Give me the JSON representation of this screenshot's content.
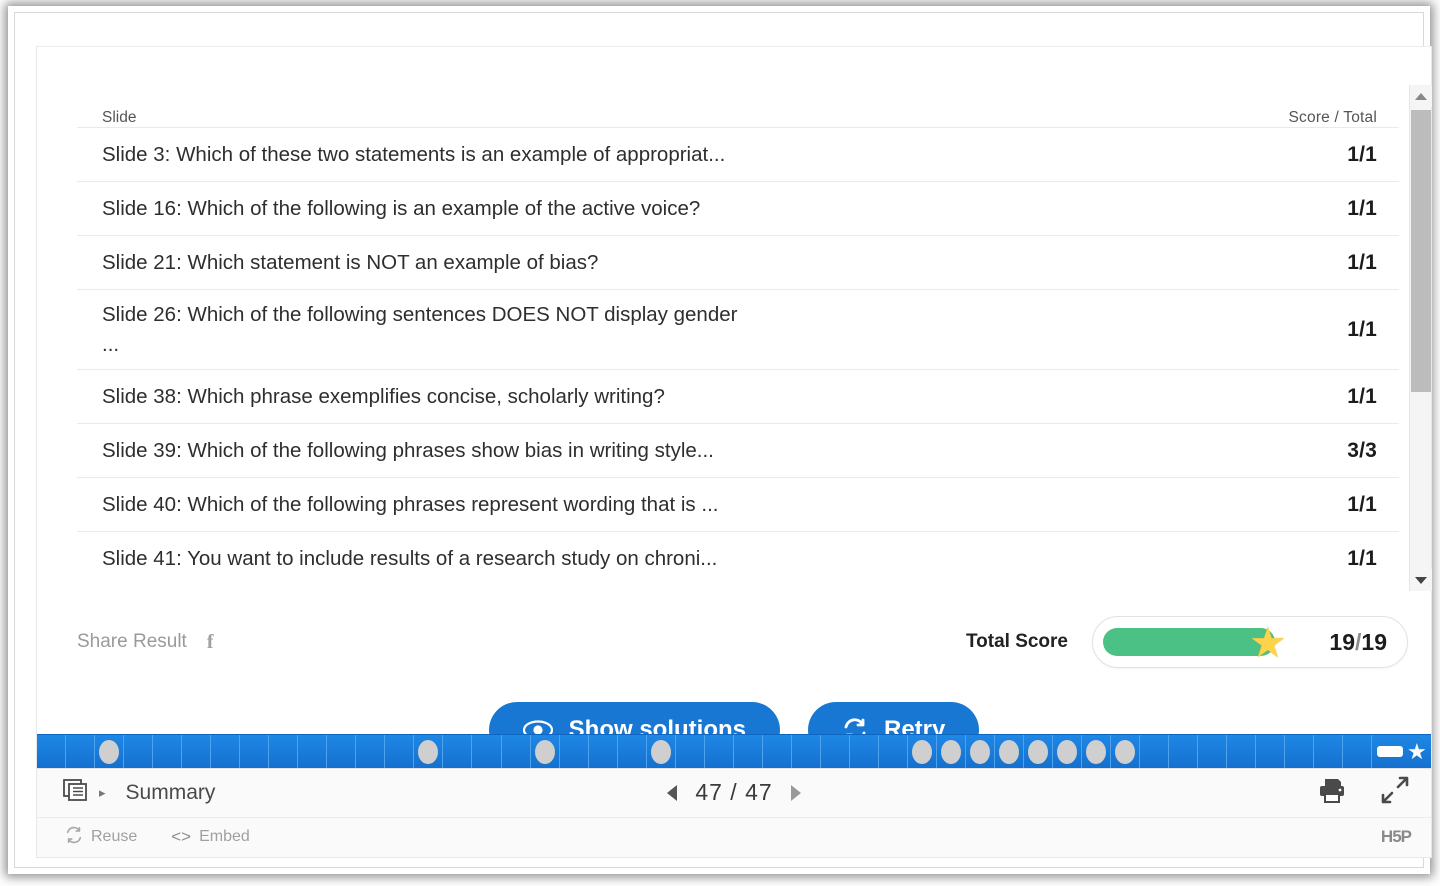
{
  "table": {
    "header_slide": "Slide",
    "header_score": "Score / Total",
    "rows": [
      {
        "text": "Slide 3: Which of these two statements is an example of appropriat...",
        "score": "1/1"
      },
      {
        "text": "Slide 16: Which of the following is an example of the active voice?",
        "score": "1/1"
      },
      {
        "text": "Slide 21: Which statement is NOT an example of bias?",
        "score": "1/1"
      },
      {
        "text": "Slide 26: Which of the following sentences DOES NOT display gender\n...",
        "score": "1/1"
      },
      {
        "text": "Slide 38: Which phrase exemplifies concise, scholarly writing?",
        "score": "1/1"
      },
      {
        "text": "Slide 39: Which of the following phrases show bias in writing style...",
        "score": "3/3"
      },
      {
        "text": "Slide 40: Which of the following phrases represent wording that is ...",
        "score": "1/1"
      },
      {
        "text": "Slide 41: You want to include results of a research study on chroni...",
        "score": "1/1"
      }
    ]
  },
  "share": {
    "label": "Share Result",
    "facebook_glyph": "f"
  },
  "total": {
    "label": "Total Score",
    "score": "19",
    "separator": "/",
    "max": "19",
    "percent": 100,
    "bar_color": "#4cc185",
    "star_color": "#fcd34a"
  },
  "actions": {
    "show_solutions": "Show solutions",
    "retry": "Retry",
    "button_color": "#1877d2"
  },
  "progress": {
    "total_segments": 46,
    "dot_segments": [
      2,
      13,
      17,
      21,
      30,
      31,
      32,
      33,
      34,
      35,
      36,
      37
    ],
    "summary_label_icons": [
      "bar-mark",
      "star-mark"
    ]
  },
  "navbar": {
    "title": "Summary",
    "page_current": "47",
    "page_separator": "/",
    "page_total": "47",
    "print_icon": "printer-icon",
    "fullscreen_icon": "fullscreen-icon"
  },
  "footer": {
    "reuse": "Reuse",
    "embed": "Embed",
    "logo": "H5P"
  }
}
